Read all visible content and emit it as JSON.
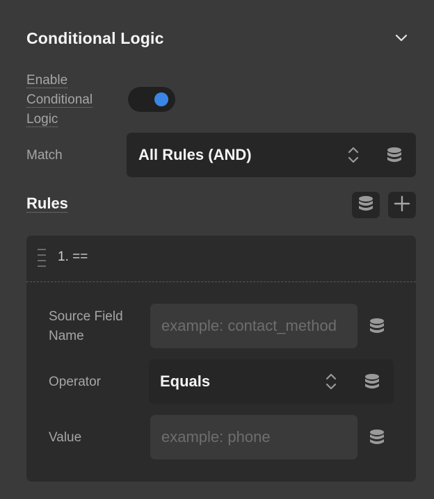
{
  "panel": {
    "title": "Conditional Logic"
  },
  "enable": {
    "label": "Enable Conditional Logic",
    "line1": "Enable",
    "line2": "Conditional",
    "line3": "Logic",
    "enabled": true
  },
  "match": {
    "label": "Match",
    "value": "All Rules (AND)"
  },
  "rules": {
    "title": "Rules",
    "items": [
      {
        "name": "1. ==",
        "source_field_label_line1": "Source Field",
        "source_field_label_line2": "Name",
        "source_field_value": "",
        "source_field_placeholder": "example: contact_method",
        "operator_label": "Operator",
        "operator_value": "Equals",
        "value_label": "Value",
        "value_value": "",
        "value_placeholder": "example: phone"
      }
    ]
  },
  "icons": {
    "collapse": "chevron-down-icon",
    "toggle": "toggle-switch",
    "sort": "up-down-chevron-icon",
    "dynamic_data": "database-icon",
    "add": "plus-icon",
    "drag": "drag-handle-icon"
  },
  "colors": {
    "background": "#3a3a3a",
    "surface": "#262626",
    "card": "#2b2b2b",
    "accent": "#3a86e6",
    "label": "#a6a6a6",
    "text": "#f5f5f5"
  }
}
